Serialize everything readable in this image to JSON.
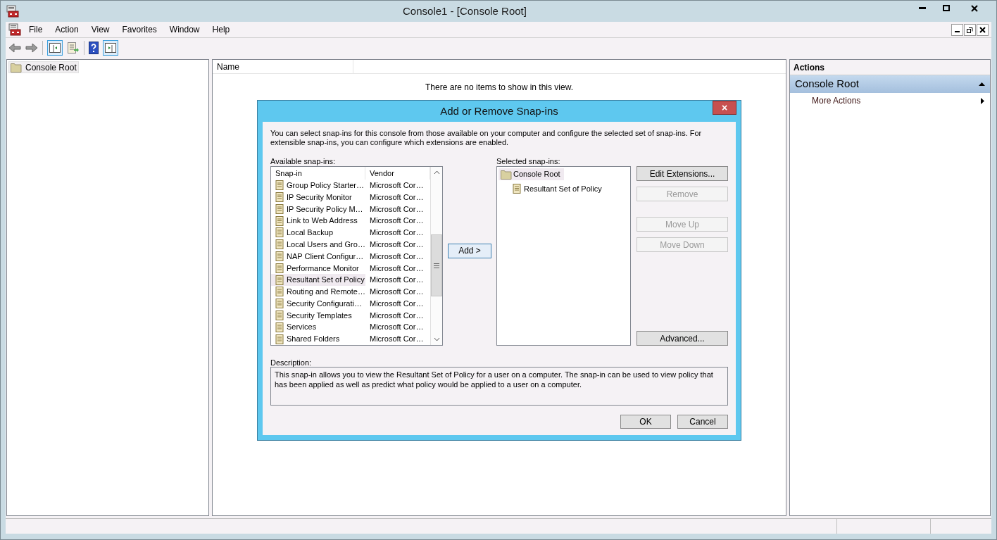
{
  "window": {
    "title": "Console1 - [Console Root]"
  },
  "menu": [
    "File",
    "Action",
    "View",
    "Favorites",
    "Window",
    "Help"
  ],
  "tree": [
    {
      "label": "Console Root",
      "selected": true
    }
  ],
  "center": {
    "columns": [
      "Name"
    ],
    "empty_text": "There are no items to show in this view."
  },
  "actions": {
    "header": "Actions",
    "section": "Console Root",
    "items": [
      "More Actions"
    ]
  },
  "dialog": {
    "title": "Add or Remove Snap-ins",
    "close": "×",
    "intro": "You can select snap-ins for this console from those available on your computer and configure the selected set of snap-ins. For extensible snap-ins, you can configure which extensions are enabled.",
    "available_label": "Available snap-ins:",
    "available_columns": [
      "Snap-in",
      "Vendor"
    ],
    "available": [
      {
        "name": "Group Policy Starter…",
        "vendor": "Microsoft Cor…",
        "selected": false
      },
      {
        "name": "IP Security Monitor",
        "vendor": "Microsoft Cor…",
        "selected": false
      },
      {
        "name": "IP Security Policy M…",
        "vendor": "Microsoft Cor…",
        "selected": false
      },
      {
        "name": "Link to Web Address",
        "vendor": "Microsoft Cor…",
        "selected": false
      },
      {
        "name": "Local Backup",
        "vendor": "Microsoft Cor…",
        "selected": false
      },
      {
        "name": "Local Users and Gro…",
        "vendor": "Microsoft Cor…",
        "selected": false
      },
      {
        "name": "NAP Client Configur…",
        "vendor": "Microsoft Cor…",
        "selected": false
      },
      {
        "name": "Performance Monitor",
        "vendor": "Microsoft Cor…",
        "selected": false
      },
      {
        "name": "Resultant Set of Policy",
        "vendor": "Microsoft Cor…",
        "selected": true
      },
      {
        "name": "Routing and Remote…",
        "vendor": "Microsoft Cor…",
        "selected": false
      },
      {
        "name": "Security Configurati…",
        "vendor": "Microsoft Cor…",
        "selected": false
      },
      {
        "name": "Security Templates",
        "vendor": "Microsoft Cor…",
        "selected": false
      },
      {
        "name": "Services",
        "vendor": "Microsoft Cor…",
        "selected": false
      },
      {
        "name": "Shared Folders",
        "vendor": "Microsoft Cor…",
        "selected": false
      }
    ],
    "add_button": "Add >",
    "selected_label": "Selected snap-ins:",
    "selected_tree": [
      {
        "label": "Console Root",
        "selected": true,
        "children": [
          {
            "label": "Resultant Set of Policy",
            "selected": false
          }
        ]
      }
    ],
    "side_buttons": [
      {
        "label": "Edit Extensions...",
        "disabled": false
      },
      {
        "label": "Remove",
        "disabled": true
      },
      {
        "label": "Move Up",
        "disabled": true
      },
      {
        "label": "Move Down",
        "disabled": true
      },
      {
        "label": "Advanced...",
        "disabled": false
      }
    ],
    "description_label": "Description:",
    "description": "This snap-in allows you to view the Resultant Set of Policy for a user on a computer.  The snap-in can be used to view policy that has been applied as well as predict what policy would be applied to a user on a computer.",
    "ok": "OK",
    "cancel": "Cancel"
  }
}
